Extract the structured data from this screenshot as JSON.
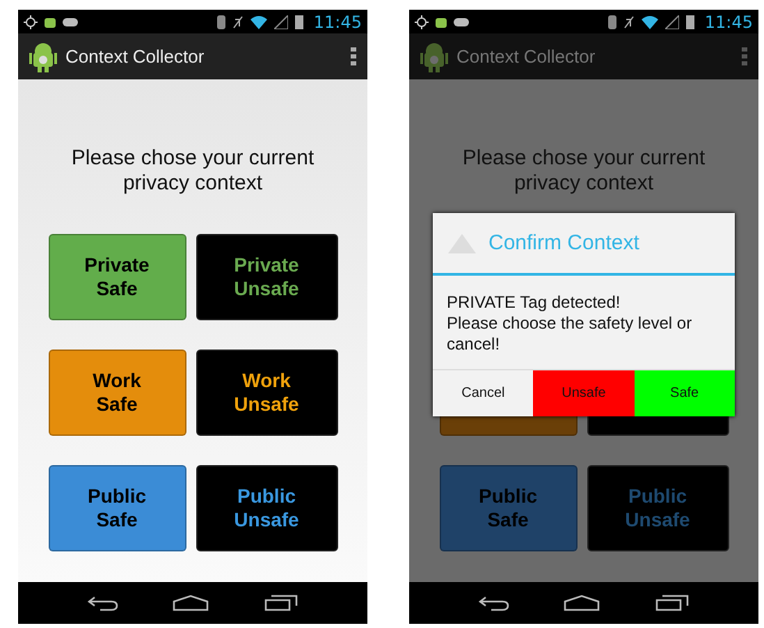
{
  "screens": [
    {
      "status_time": "11:45",
      "app_title": "Context Collector",
      "dimmed": false,
      "prompt": "Please chose your current privacy context",
      "buttons": [
        {
          "kind": "safe",
          "label": "Private\nSafe",
          "color": "#62ad4b"
        },
        {
          "kind": "unsafe",
          "label": "Private\nUnsafe",
          "color": "#6aaa50"
        },
        {
          "kind": "safe",
          "label": "Work\nSafe",
          "color": "#e48d0c"
        },
        {
          "kind": "unsafe",
          "label": "Work\nUnsafe",
          "color": "#f0a20c"
        },
        {
          "kind": "safe",
          "label": "Public\nSafe",
          "color": "#3b8cd6"
        },
        {
          "kind": "unsafe",
          "label": "Public\nUnsafe",
          "color": "#3a98e0"
        }
      ]
    },
    {
      "status_time": "11:45",
      "app_title": "Context Collector",
      "dimmed": true,
      "prompt": "Please chose your current privacy context",
      "buttons": [
        {
          "kind": "covered"
        },
        {
          "kind": "covered"
        },
        {
          "kind": "safe",
          "color": "#6a3f08"
        },
        {
          "kind": "unsafe"
        },
        {
          "kind": "safe",
          "label": "Public\nSafe",
          "color": "#1f4268"
        },
        {
          "kind": "unsafe",
          "label": "Public\nUnsafe",
          "color": "#1e4a70"
        }
      ],
      "dialog": {
        "title": "Confirm Context",
        "message": "PRIVATE Tag detected!\nPlease choose the safety level or cancel!",
        "actions": [
          {
            "label": "Cancel",
            "color": "#f2f2f2"
          },
          {
            "label": "Unsafe",
            "color": "#ff0000"
          },
          {
            "label": "Safe",
            "color": "#00ff00"
          }
        ]
      }
    }
  ]
}
